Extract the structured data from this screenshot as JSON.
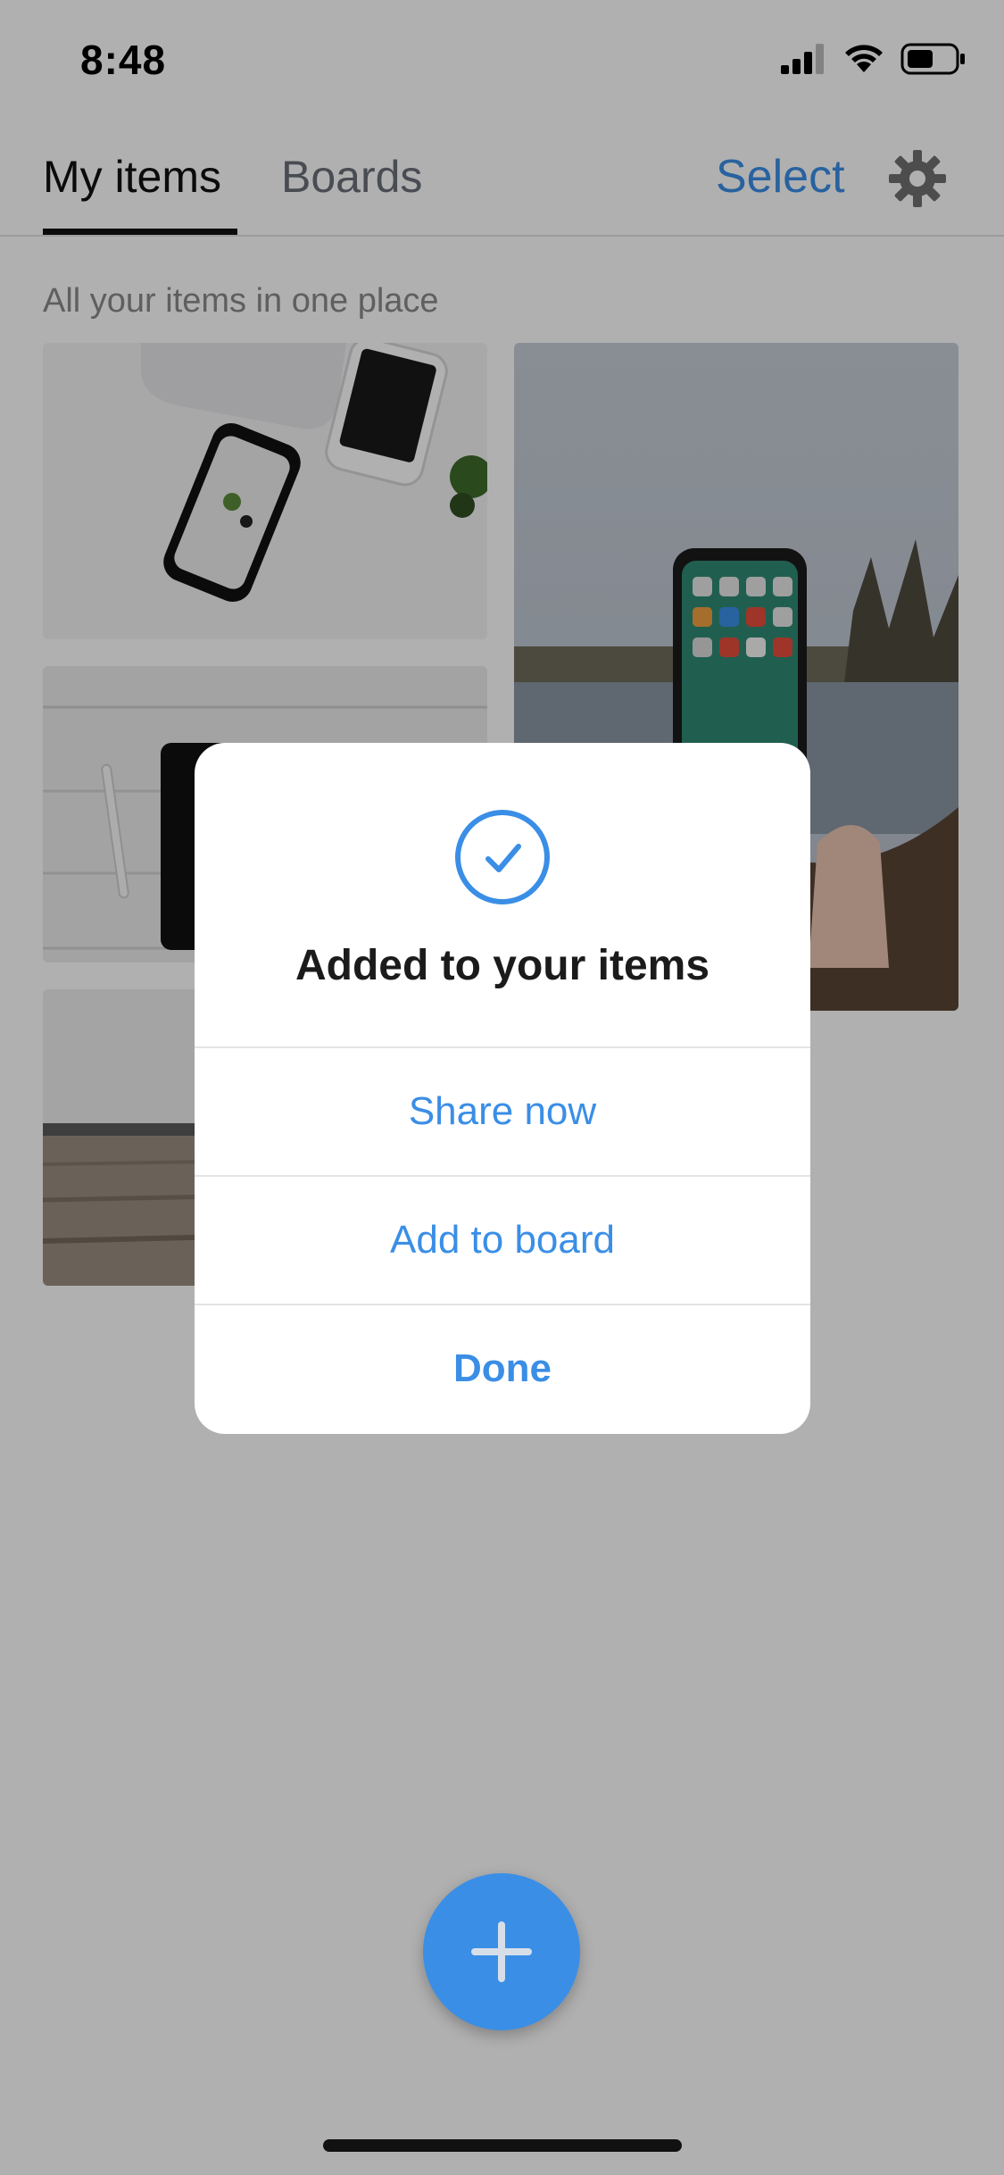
{
  "status_bar": {
    "time": "8:48",
    "icons": [
      "cellular-signal-icon",
      "wifi-icon",
      "battery-icon"
    ]
  },
  "header": {
    "tabs": [
      {
        "label": "My items",
        "active": true
      },
      {
        "label": "Boards",
        "active": false
      }
    ],
    "select_label": "Select",
    "settings_icon": "gear-icon"
  },
  "subtitle": "All your items in one place",
  "items": [
    {
      "name": "item-photo-phones-on-desk"
    },
    {
      "name": "item-photo-tablet-and-pencil"
    },
    {
      "name": "item-photo-wooden-floor"
    },
    {
      "name": "item-photo-phone-held-by-lake"
    }
  ],
  "dialog": {
    "icon": "check-circle-icon",
    "title": "Added to your items",
    "buttons": [
      {
        "label": "Share now"
      },
      {
        "label": "Add to board"
      },
      {
        "label": "Done"
      }
    ]
  },
  "fab": {
    "icon": "plus-icon"
  },
  "colors": {
    "accent": "#3a8ee6",
    "overlay": "rgba(0,0,0,0.31)",
    "tab_inactive": "#6a6e78",
    "subtitle": "#8a8a8a"
  }
}
